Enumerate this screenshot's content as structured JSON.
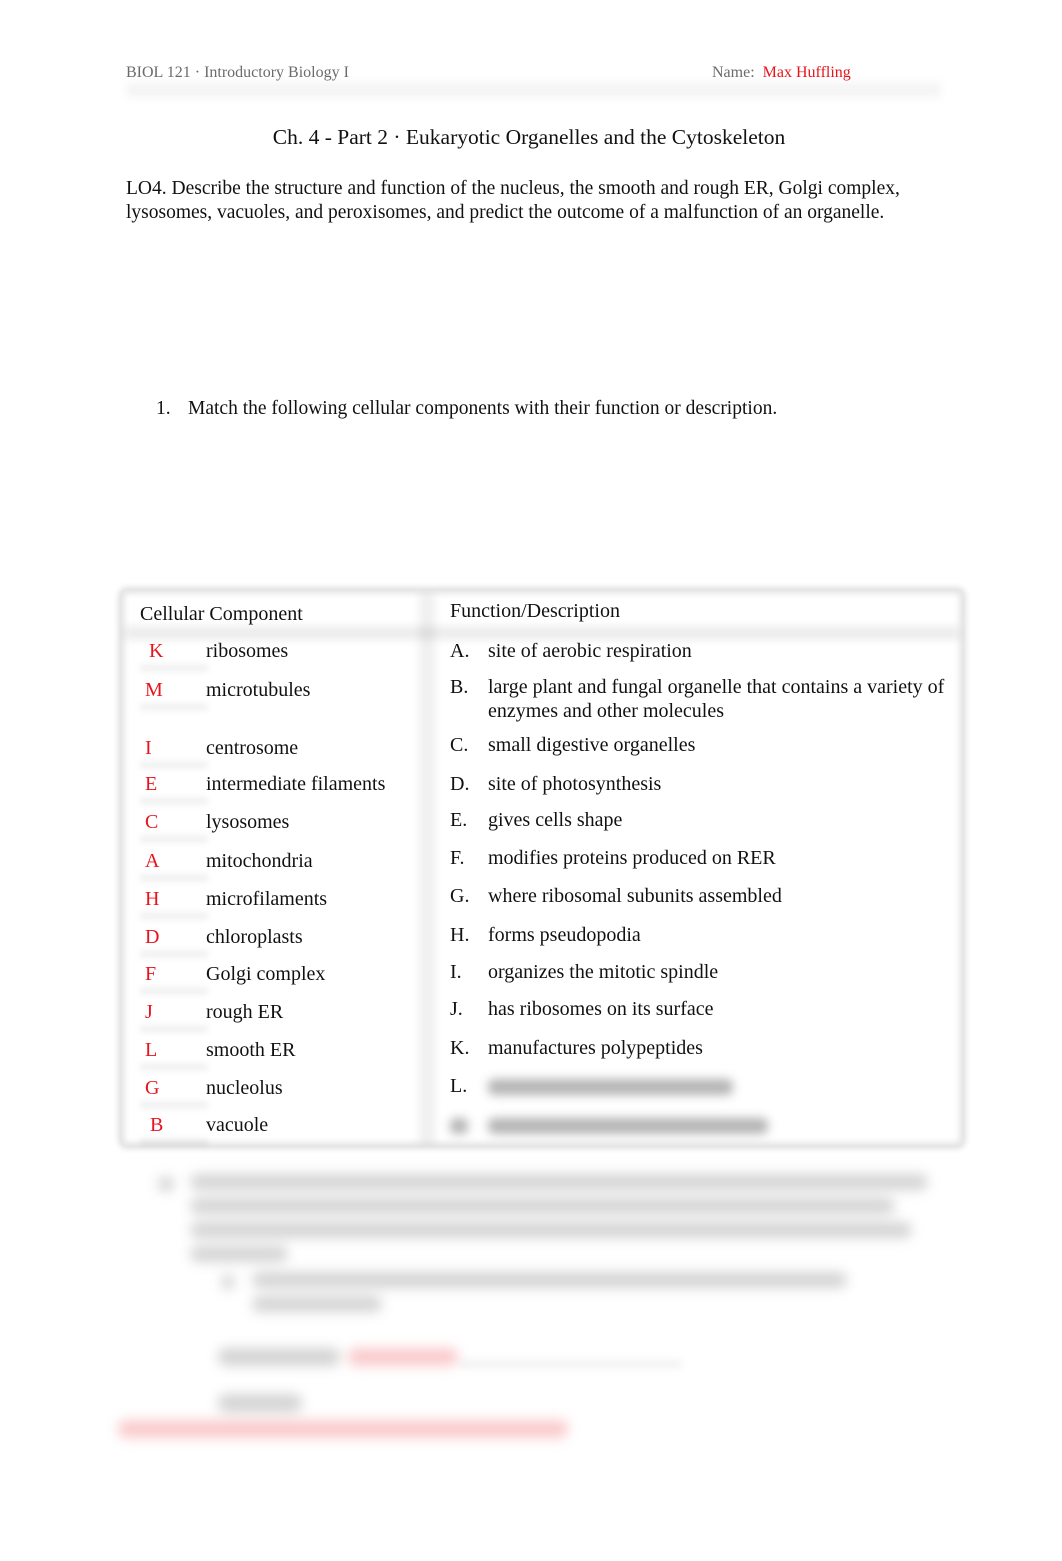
{
  "header": {
    "course": "BIOL 121 · Introductory Biology I",
    "name_label": "Name:",
    "student_name": "Max Huffling"
  },
  "title": "Ch. 4 - Part 2 · Eukaryotic Organelles and the Cytoskeleton",
  "learning_objective": "LO4. Describe the structure and function of the nucleus, the smooth and rough ER, Golgi complex, lysosomes, vacuoles, and peroxisomes, and predict the outcome of a malfunction of an organelle.",
  "question1": {
    "number": "1.",
    "text": "Match the following cellular components with their function or description."
  },
  "table": {
    "col_left_header": "Cellular Component",
    "col_right_header": "Function/Description",
    "components": [
      {
        "answer": "K",
        "name": "ribosomes"
      },
      {
        "answer": "M",
        "name": "microtubules"
      },
      {
        "answer": "I",
        "name": "centrosome"
      },
      {
        "answer": "E",
        "name": "intermediate filaments"
      },
      {
        "answer": "C",
        "name": "lysosomes"
      },
      {
        "answer": "A",
        "name": "mitochondria"
      },
      {
        "answer": "H",
        "name": "microfilaments"
      },
      {
        "answer": "D",
        "name": "chloroplasts"
      },
      {
        "answer": "F",
        "name": "Golgi complex"
      },
      {
        "answer": "J",
        "name": "rough ER"
      },
      {
        "answer": "L",
        "name": "smooth ER"
      },
      {
        "answer": "G",
        "name": "nucleolus"
      },
      {
        "answer": "B",
        "name": "vacuole"
      }
    ],
    "descriptions": [
      {
        "letter": "A.",
        "text": "site of aerobic respiration"
      },
      {
        "letter": "B.",
        "text": "large plant and fungal organelle that contains a variety of enzymes and other molecules"
      },
      {
        "letter": "C.",
        "text": "small digestive organelles"
      },
      {
        "letter": "D.",
        "text": "site of photosynthesis"
      },
      {
        "letter": "E.",
        "text": "gives cells shape"
      },
      {
        "letter": "F.",
        "text": "modifies proteins produced on RER"
      },
      {
        "letter": "G.",
        "text": "where ribosomal subunits assembled"
      },
      {
        "letter": "H.",
        "text": "forms pseudopodia"
      },
      {
        "letter": "I.",
        "text": "organizes the mitotic spindle"
      },
      {
        "letter": "J.",
        "text": "has ribosomes on its surface"
      },
      {
        "letter": "K.",
        "text": "manufactures polypeptides"
      },
      {
        "letter": "L.",
        "text": ""
      },
      {
        "letter": "",
        "text": ""
      }
    ]
  },
  "colors": {
    "answer_red": "#e8141c",
    "header_gray": "#6b6b6b",
    "text": "#111111"
  }
}
